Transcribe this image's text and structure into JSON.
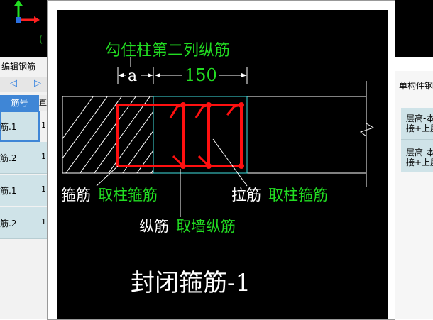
{
  "left": {
    "panel_title": "编辑钢筋",
    "column_header": "筋号",
    "column_header2": "直",
    "rows": [
      {
        "label": "筋.1",
        "side": "1"
      },
      {
        "label": "筋.2",
        "side": "1"
      },
      {
        "label": "筋.1",
        "side": "1"
      },
      {
        "label": "筋.2",
        "side": "1"
      }
    ]
  },
  "right": {
    "panel_title": "单构件钢",
    "rows": [
      {
        "text": "层高-本\n接+上层"
      },
      {
        "text": "层高-本\n接+上层"
      }
    ]
  },
  "diagram": {
    "top_label": "勾住柱第二列纵筋",
    "dim_a": "a",
    "dim_150": "150",
    "stirrup_label": "箍筋",
    "stirrup_source": "取柱箍筋",
    "tie_label": "拉筋",
    "tie_source": "取柱箍筋",
    "long_label": "纵筋",
    "long_source": "取墙纵筋",
    "caption": "封闭箍筋-1"
  },
  "colors": {
    "canvas_bg": "#000000",
    "green": "#22dd22",
    "red": "#ff1010",
    "white": "#ffffff",
    "cyan": "#40e0e0"
  }
}
